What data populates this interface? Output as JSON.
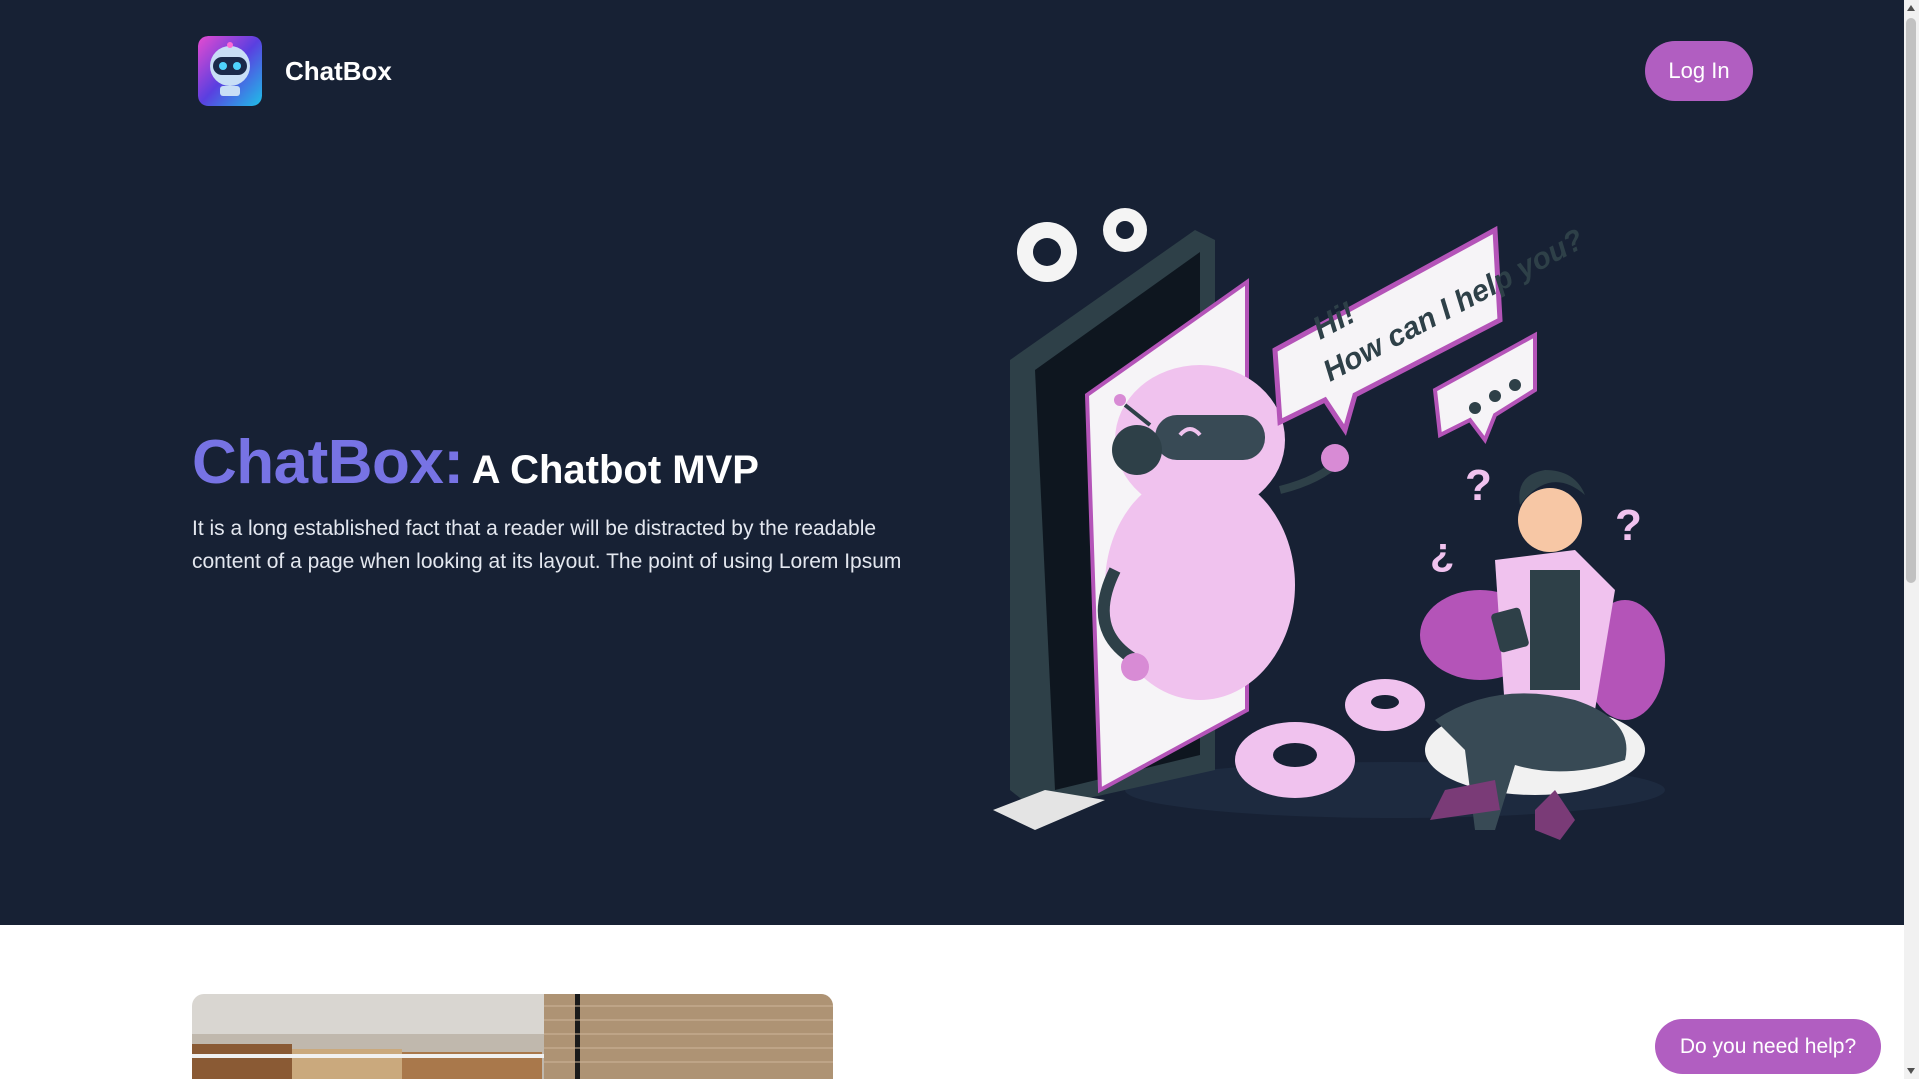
{
  "header": {
    "brand_name": "ChatBox",
    "login_label": "Log In",
    "logo_icon": "robot-logo-icon"
  },
  "hero": {
    "headline_brand": "ChatBox:",
    "headline_sub": "A Chatbot MVP",
    "description": "It is a long established fact that a reader will be distracted by the readable content of a page when looking at its layout. The point of using Lorem Ipsum",
    "illustration": {
      "bubble_line1": "Hi!",
      "bubble_line2": "How can I help you?"
    }
  },
  "help_button": {
    "label": "Do you need help?"
  },
  "colors": {
    "hero_bg": "#172134",
    "accent_purple": "#b15ec1",
    "headline_blue": "#7773e4",
    "pink_light": "#f0c2ee",
    "pink_mid": "#d88bd5",
    "phone_dark": "#2e4048"
  }
}
